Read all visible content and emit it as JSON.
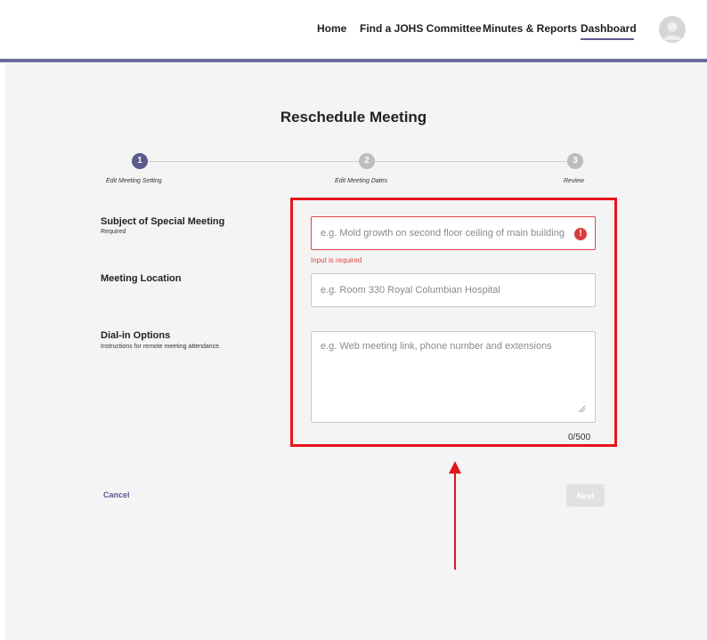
{
  "nav": {
    "items": [
      {
        "label": "Home"
      },
      {
        "label": "Find a JOHS Committee"
      },
      {
        "label": "Minutes & Reports"
      },
      {
        "label": "Dashboard",
        "active": true
      }
    ]
  },
  "page": {
    "title": "Reschedule Meeting"
  },
  "stepper": {
    "steps": [
      {
        "number": "1",
        "label": "Edit Meeting Setting",
        "state": "active"
      },
      {
        "number": "2",
        "label": "Edit Meeting Dates",
        "state": "inactive"
      },
      {
        "number": "3",
        "label": "Review",
        "state": "inactive"
      }
    ]
  },
  "form": {
    "subject": {
      "label": "Subject of Special Meeting",
      "sublabel": "Required",
      "placeholder": "e.g. Mold growth on second floor ceiling of main building",
      "value": "",
      "error": "Input is required",
      "error_icon": "!"
    },
    "location": {
      "label": "Meeting Location",
      "placeholder": "e.g. Room 330 Royal Columbian Hospital",
      "value": ""
    },
    "dial_in": {
      "label": "Dial-in Options",
      "sublabel": "Instructions for remote meeting attendance.",
      "placeholder": "e.g. Web meeting link, phone number and extensions",
      "value": "",
      "char_count": "0/500"
    }
  },
  "actions": {
    "cancel_label": "Cancel",
    "next_label": "Next"
  },
  "colors": {
    "accent": "#5b5b8e",
    "header_bar": "#6b6a9c",
    "error": "#e04646",
    "annotation": "#e8141a",
    "panel_bg": "#f4f4f4"
  }
}
